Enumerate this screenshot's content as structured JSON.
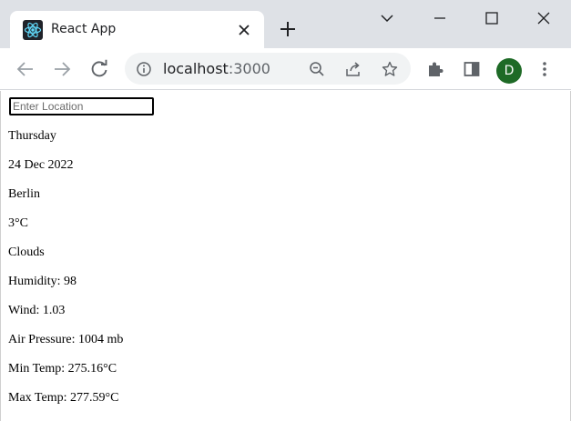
{
  "browser": {
    "tab_title": "React App",
    "url_host": "localhost",
    "url_port": ":3000",
    "profile_initial": "D"
  },
  "search": {
    "placeholder": "Enter Location",
    "value": ""
  },
  "weather": {
    "day": "Thursday",
    "date": "24 Dec 2022",
    "city": "Berlin",
    "temperature": "3°C",
    "condition": "Clouds",
    "humidity": "Humidity: 98",
    "wind": "Wind: 1.03",
    "pressure": "Air Pressure: 1004 mb",
    "min_temp": "Min Temp: 275.16°C",
    "max_temp": "Max Temp: 277.59°C"
  },
  "colors": {
    "chrome_bg": "#dee1e6",
    "avatar_bg": "#1e6a26",
    "react_logo": "#61dafb"
  }
}
